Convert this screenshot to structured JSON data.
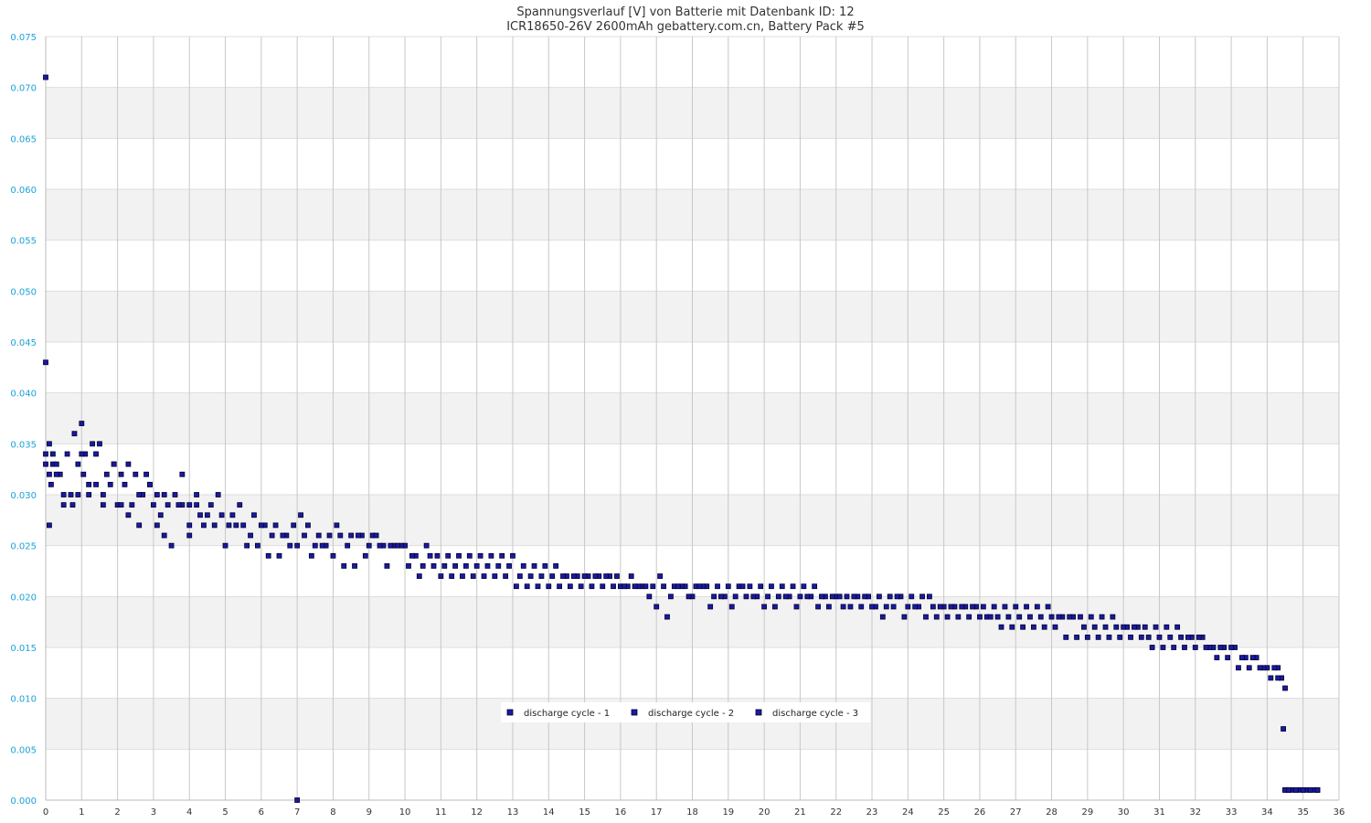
{
  "chart_data": {
    "type": "scatter",
    "title": "Spannungsverlauf [V] von Batterie mit Datenbank ID: 12",
    "subtitle": "ICR18650-26V 2600mAh gebattery.com.cn, Battery Pack #5",
    "xlabel": "",
    "ylabel": "",
    "xlim": [
      0,
      36
    ],
    "ylim": [
      0,
      0.075
    ],
    "x_ticks": [
      "0",
      "1",
      "2",
      "3",
      "4",
      "5",
      "6",
      "7",
      "8",
      "9",
      "10",
      "11",
      "12",
      "13",
      "14",
      "15",
      "16",
      "17",
      "18",
      "19",
      "20",
      "21",
      "22",
      "23",
      "24",
      "25",
      "26",
      "27",
      "28",
      "29",
      "30",
      "31",
      "32",
      "33",
      "34",
      "35",
      "36"
    ],
    "y_ticks": [
      "0.000",
      "0.005",
      "0.010",
      "0.015",
      "0.020",
      "0.025",
      "0.030",
      "0.035",
      "0.040",
      "0.045",
      "0.050",
      "0.055",
      "0.060",
      "0.065",
      "0.070",
      "0.075"
    ],
    "grid": true,
    "legend_position": "bottom-center",
    "marker_fill": "#1a1aa0",
    "marker_stroke": "#000033",
    "band_color": "#f2f2f2",
    "y_tick_color": "#1aa3d6",
    "series": [
      {
        "name": "discharge cycle - 1",
        "x": [
          0.0,
          0.0,
          0.1,
          0.2,
          0.3,
          0.5,
          0.7,
          0.9,
          1.0,
          1.1,
          1.3,
          1.5,
          1.7,
          1.9,
          2.1,
          2.3,
          2.5,
          2.7,
          2.9,
          3.1,
          3.3,
          3.6,
          3.8,
          4.0,
          4.3,
          4.6,
          4.9,
          5.2,
          5.5,
          5.8,
          6.1,
          6.4,
          6.7,
          7.0,
          7.3,
          7.6,
          7.9,
          8.2,
          8.5,
          8.8,
          9.1,
          9.4,
          9.7,
          10.0,
          10.3,
          10.6,
          10.9,
          11.2,
          11.5,
          11.8,
          12.1,
          12.4,
          12.7,
          13.0,
          13.3,
          13.6,
          13.9,
          14.2,
          14.5,
          14.8,
          15.1,
          15.4,
          15.7,
          16.0,
          16.3,
          16.6,
          16.9,
          17.2,
          17.5,
          17.8,
          18.1,
          18.4,
          18.7,
          19.0,
          19.3,
          19.6,
          19.9,
          20.2,
          20.5,
          20.8,
          21.1,
          21.4,
          21.7,
          22.0,
          22.3,
          22.6,
          22.9,
          23.2,
          23.5,
          23.8,
          24.1,
          24.4,
          24.7,
          25.0,
          25.3,
          25.6,
          25.9,
          26.2,
          26.5,
          26.8,
          27.1,
          27.4,
          27.7,
          28.0,
          28.3,
          28.6,
          28.9,
          29.2,
          29.5,
          29.8,
          30.1,
          30.4,
          30.7,
          31.0,
          31.3,
          31.6,
          31.9,
          32.2,
          32.5,
          32.8,
          33.1,
          33.4,
          33.7,
          34.0,
          34.3,
          34.5,
          34.6,
          34.7,
          34.9,
          35.1,
          35.3,
          35.4
        ],
        "y": [
          0.071,
          0.043,
          0.035,
          0.033,
          0.033,
          0.03,
          0.03,
          0.033,
          0.037,
          0.034,
          0.035,
          0.035,
          0.032,
          0.033,
          0.032,
          0.033,
          0.032,
          0.03,
          0.031,
          0.03,
          0.03,
          0.03,
          0.029,
          0.029,
          0.028,
          0.029,
          0.028,
          0.028,
          0.027,
          0.028,
          0.027,
          0.027,
          0.026,
          0.025,
          0.027,
          0.026,
          0.026,
          0.026,
          0.026,
          0.026,
          0.026,
          0.025,
          0.025,
          0.025,
          0.024,
          0.025,
          0.024,
          0.024,
          0.024,
          0.024,
          0.024,
          0.024,
          0.024,
          0.024,
          0.023,
          0.023,
          0.023,
          0.023,
          0.022,
          0.022,
          0.022,
          0.022,
          0.022,
          0.021,
          0.022,
          0.021,
          0.021,
          0.021,
          0.021,
          0.021,
          0.021,
          0.021,
          0.021,
          0.021,
          0.021,
          0.021,
          0.021,
          0.021,
          0.021,
          0.021,
          0.021,
          0.021,
          0.02,
          0.02,
          0.02,
          0.02,
          0.02,
          0.02,
          0.02,
          0.02,
          0.02,
          0.02,
          0.019,
          0.019,
          0.019,
          0.019,
          0.019,
          0.018,
          0.018,
          0.018,
          0.018,
          0.018,
          0.018,
          0.018,
          0.018,
          0.018,
          0.017,
          0.017,
          0.017,
          0.017,
          0.017,
          0.017,
          0.016,
          0.016,
          0.016,
          0.016,
          0.016,
          0.016,
          0.015,
          0.015,
          0.015,
          0.014,
          0.014,
          0.013,
          0.013,
          0.001,
          0.001,
          0.001,
          0.001,
          0.001,
          0.001,
          0.001
        ]
      },
      {
        "name": "discharge cycle - 2",
        "x": [
          0.0,
          0.1,
          0.2,
          0.4,
          0.6,
          0.8,
          1.0,
          1.2,
          1.4,
          1.6,
          1.8,
          2.0,
          2.2,
          2.4,
          2.6,
          2.8,
          3.0,
          3.2,
          3.4,
          3.7,
          4.0,
          4.2,
          4.5,
          4.8,
          5.1,
          5.4,
          5.7,
          6.0,
          6.3,
          6.6,
          6.9,
          7.0,
          7.2,
          7.5,
          7.8,
          8.1,
          8.4,
          8.7,
          9.0,
          9.3,
          9.6,
          9.9,
          10.2,
          10.5,
          10.8,
          11.1,
          11.4,
          11.7,
          12.0,
          12.3,
          12.6,
          12.9,
          13.2,
          13.5,
          13.8,
          14.1,
          14.4,
          14.7,
          15.0,
          15.3,
          15.6,
          15.9,
          16.2,
          16.5,
          16.8,
          17.1,
          17.4,
          17.7,
          18.0,
          18.3,
          18.6,
          18.9,
          19.2,
          19.5,
          19.8,
          20.1,
          20.4,
          20.7,
          21.0,
          21.3,
          21.6,
          21.9,
          22.2,
          22.5,
          22.8,
          23.1,
          23.4,
          23.7,
          24.0,
          24.3,
          24.6,
          24.9,
          25.2,
          25.5,
          25.8,
          26.1,
          26.4,
          26.7,
          27.0,
          27.3,
          27.6,
          27.9,
          28.2,
          28.5,
          28.8,
          29.1,
          29.4,
          29.7,
          30.0,
          30.3,
          30.6,
          30.9,
          31.2,
          31.5,
          31.8,
          32.1,
          32.4,
          32.7,
          33.0,
          33.3,
          33.6,
          33.9,
          34.2,
          34.4,
          34.5,
          34.6,
          34.8,
          35.0,
          35.2,
          35.4
        ],
        "y": [
          0.033,
          0.032,
          0.034,
          0.032,
          0.034,
          0.036,
          0.034,
          0.031,
          0.034,
          0.03,
          0.031,
          0.029,
          0.031,
          0.029,
          0.03,
          0.032,
          0.029,
          0.028,
          0.029,
          0.029,
          0.027,
          0.03,
          0.028,
          0.03,
          0.027,
          0.029,
          0.026,
          0.027,
          0.026,
          0.026,
          0.027,
          0.0,
          0.026,
          0.025,
          0.025,
          0.027,
          0.025,
          0.026,
          0.025,
          0.025,
          0.025,
          0.025,
          0.024,
          0.023,
          0.023,
          0.023,
          0.023,
          0.023,
          0.023,
          0.023,
          0.023,
          0.023,
          0.022,
          0.022,
          0.022,
          0.022,
          0.022,
          0.022,
          0.022,
          0.022,
          0.022,
          0.022,
          0.021,
          0.021,
          0.02,
          0.022,
          0.02,
          0.021,
          0.02,
          0.021,
          0.02,
          0.02,
          0.02,
          0.02,
          0.02,
          0.02,
          0.02,
          0.02,
          0.02,
          0.02,
          0.02,
          0.02,
          0.019,
          0.02,
          0.02,
          0.019,
          0.019,
          0.02,
          0.019,
          0.019,
          0.02,
          0.019,
          0.019,
          0.019,
          0.019,
          0.019,
          0.019,
          0.019,
          0.019,
          0.019,
          0.019,
          0.019,
          0.018,
          0.018,
          0.018,
          0.018,
          0.018,
          0.018,
          0.017,
          0.017,
          0.017,
          0.017,
          0.017,
          0.017,
          0.016,
          0.016,
          0.015,
          0.015,
          0.015,
          0.014,
          0.014,
          0.013,
          0.013,
          0.012,
          0.011,
          0.001,
          0.001,
          0.001,
          0.001,
          0.001
        ]
      },
      {
        "name": "discharge cycle - 3",
        "x": [
          0.0,
          0.1,
          0.15,
          0.3,
          0.5,
          0.75,
          0.9,
          1.05,
          1.2,
          1.4,
          1.6,
          1.9,
          2.1,
          2.3,
          2.6,
          2.9,
          3.1,
          3.3,
          3.5,
          3.8,
          4.0,
          4.2,
          4.4,
          4.7,
          5.0,
          5.3,
          5.6,
          5.9,
          6.2,
          6.5,
          6.8,
          7.1,
          7.4,
          7.7,
          8.0,
          8.3,
          8.6,
          8.9,
          9.2,
          9.5,
          9.8,
          10.1,
          10.4,
          10.7,
          11.0,
          11.3,
          11.6,
          11.9,
          12.2,
          12.5,
          12.8,
          13.1,
          13.4,
          13.7,
          14.0,
          14.3,
          14.6,
          14.9,
          15.2,
          15.5,
          15.8,
          16.1,
          16.4,
          16.7,
          17.0,
          17.3,
          17.6,
          17.9,
          18.2,
          18.5,
          18.8,
          19.1,
          19.4,
          19.7,
          20.0,
          20.3,
          20.6,
          20.9,
          21.2,
          21.5,
          21.8,
          22.1,
          22.4,
          22.7,
          23.0,
          23.3,
          23.6,
          23.9,
          24.2,
          24.5,
          24.8,
          25.1,
          25.4,
          25.7,
          26.0,
          26.3,
          26.6,
          26.9,
          27.2,
          27.5,
          27.8,
          28.1,
          28.4,
          28.7,
          29.0,
          29.3,
          29.6,
          29.9,
          30.2,
          30.5,
          30.8,
          31.1,
          31.4,
          31.7,
          32.0,
          32.3,
          32.6,
          32.9,
          33.2,
          33.5,
          33.8,
          34.1,
          34.3,
          34.45,
          34.5,
          34.6,
          34.8,
          35.0,
          35.2,
          35.4
        ],
        "y": [
          0.034,
          0.027,
          0.031,
          0.032,
          0.029,
          0.029,
          0.03,
          0.032,
          0.03,
          0.031,
          0.029,
          0.033,
          0.029,
          0.028,
          0.027,
          0.031,
          0.027,
          0.026,
          0.025,
          0.032,
          0.026,
          0.029,
          0.027,
          0.027,
          0.025,
          0.027,
          0.025,
          0.025,
          0.024,
          0.024,
          0.025,
          0.028,
          0.024,
          0.025,
          0.024,
          0.023,
          0.023,
          0.024,
          0.026,
          0.023,
          0.025,
          0.023,
          0.022,
          0.024,
          0.022,
          0.022,
          0.022,
          0.022,
          0.022,
          0.022,
          0.022,
          0.021,
          0.021,
          0.021,
          0.021,
          0.021,
          0.021,
          0.021,
          0.021,
          0.021,
          0.021,
          0.021,
          0.021,
          0.021,
          0.019,
          0.018,
          0.021,
          0.02,
          0.021,
          0.019,
          0.02,
          0.019,
          0.021,
          0.02,
          0.019,
          0.019,
          0.02,
          0.019,
          0.02,
          0.019,
          0.019,
          0.02,
          0.019,
          0.019,
          0.019,
          0.018,
          0.019,
          0.018,
          0.019,
          0.018,
          0.018,
          0.018,
          0.018,
          0.018,
          0.018,
          0.018,
          0.017,
          0.017,
          0.017,
          0.017,
          0.017,
          0.017,
          0.016,
          0.016,
          0.016,
          0.016,
          0.016,
          0.016,
          0.016,
          0.016,
          0.015,
          0.015,
          0.015,
          0.015,
          0.015,
          0.015,
          0.014,
          0.014,
          0.013,
          0.013,
          0.013,
          0.012,
          0.012,
          0.007,
          0.001,
          0.001,
          0.001,
          0.001,
          0.001,
          0.001
        ]
      }
    ]
  }
}
